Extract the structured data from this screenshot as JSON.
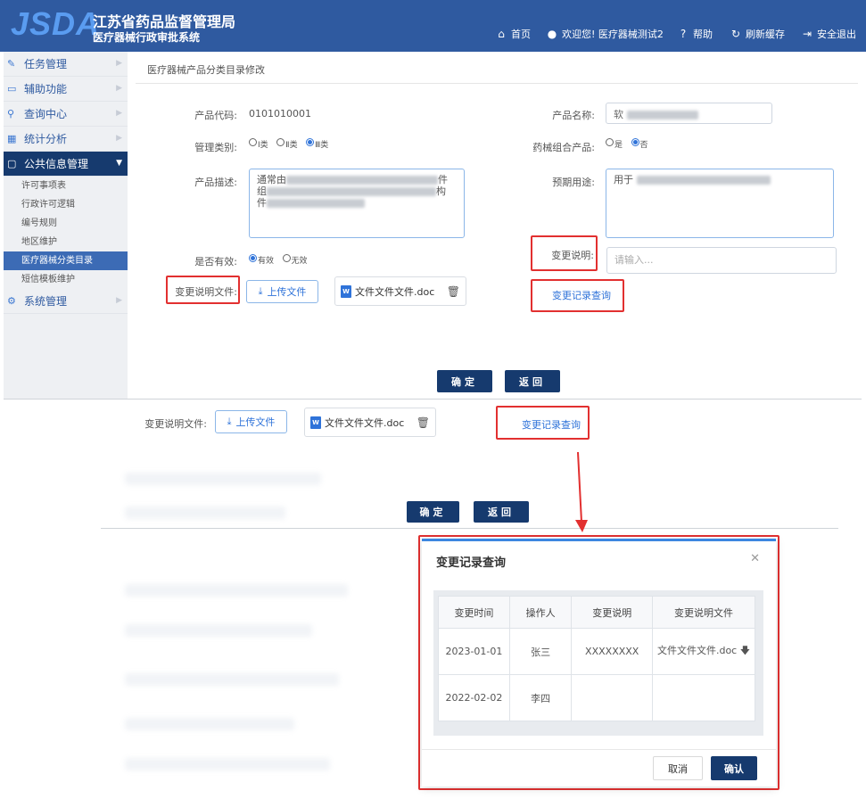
{
  "header": {
    "logo": "JSDA",
    "org_name": "江苏省药品监督管理局",
    "system_name": "医疗器械行政审批系统",
    "nav": {
      "home": "首页",
      "welcome": "欢迎您! 医疗器械测试2",
      "help": "帮助",
      "refresh": "刷新缓存",
      "logout": "安全退出"
    }
  },
  "sidebar": {
    "items": [
      {
        "label": "任务管理",
        "icon": "edit-icon"
      },
      {
        "label": "辅助功能",
        "icon": "monitor-icon"
      },
      {
        "label": "查询中心",
        "icon": "search-icon"
      },
      {
        "label": "统计分析",
        "icon": "chart-icon"
      },
      {
        "label": "公共信息管理",
        "icon": "folder-icon"
      }
    ],
    "subitems": [
      "许可事项表",
      "行政许可逻辑",
      "编号规则",
      "地区维护",
      "医疗器械分类目录",
      "短信模板维护"
    ],
    "last_item": {
      "label": "系统管理",
      "icon": "gear-icon"
    }
  },
  "breadcrumb": "医疗器械产品分类目录修改",
  "form": {
    "product_code_label": "产品代码:",
    "product_code": "0101010001",
    "product_name_label": "产品名称:",
    "product_name": "软",
    "mgmt_category_label": "管理类别:",
    "mgmt_options": [
      "Ⅰ类",
      "Ⅱ类",
      "Ⅲ类"
    ],
    "combo_label": "药械组合产品:",
    "combo_options": [
      "是",
      "否"
    ],
    "desc_label": "产品描述:",
    "desc_text": [
      "通常由",
      "件",
      "组",
      "构",
      "件"
    ],
    "use_label": "预期用途:",
    "use_text": "用于",
    "valid_label": "是否有效:",
    "valid_options": [
      "有效",
      "无效"
    ],
    "change_note_label": "变更说明:",
    "change_note_placeholder": "请输入...",
    "change_file_label": "变更说明文件:",
    "upload_label": "上传文件",
    "file_name": "文件文件文件.doc",
    "file_badge": "W",
    "history_link": "变更记录查询",
    "ok_label": "确定",
    "back_label": "返回"
  },
  "zoom": {
    "change_file_label": "变更说明文件:",
    "upload_label": "上传文件",
    "file_name": "文件文件文件.doc",
    "history_link": "变更记录查询",
    "ok_label": "确定",
    "back_label": "返回"
  },
  "dialog": {
    "title": "变更记录查询",
    "columns": [
      "变更时间",
      "操作人",
      "变更说明",
      "变更说明文件"
    ],
    "rows": [
      {
        "time": "2023-01-01",
        "operator": "张三",
        "note": "XXXXXXXX",
        "file": "文件文件文件.doc"
      },
      {
        "time": "2022-02-02",
        "operator": "李四",
        "note": "",
        "file": ""
      }
    ],
    "cancel_label": "取消",
    "confirm_label": "确认"
  },
  "colors": {
    "header": "#2f5aa0",
    "accent": "#2f73d9",
    "dark_button": "#163a6e",
    "highlight": "#e23030"
  }
}
